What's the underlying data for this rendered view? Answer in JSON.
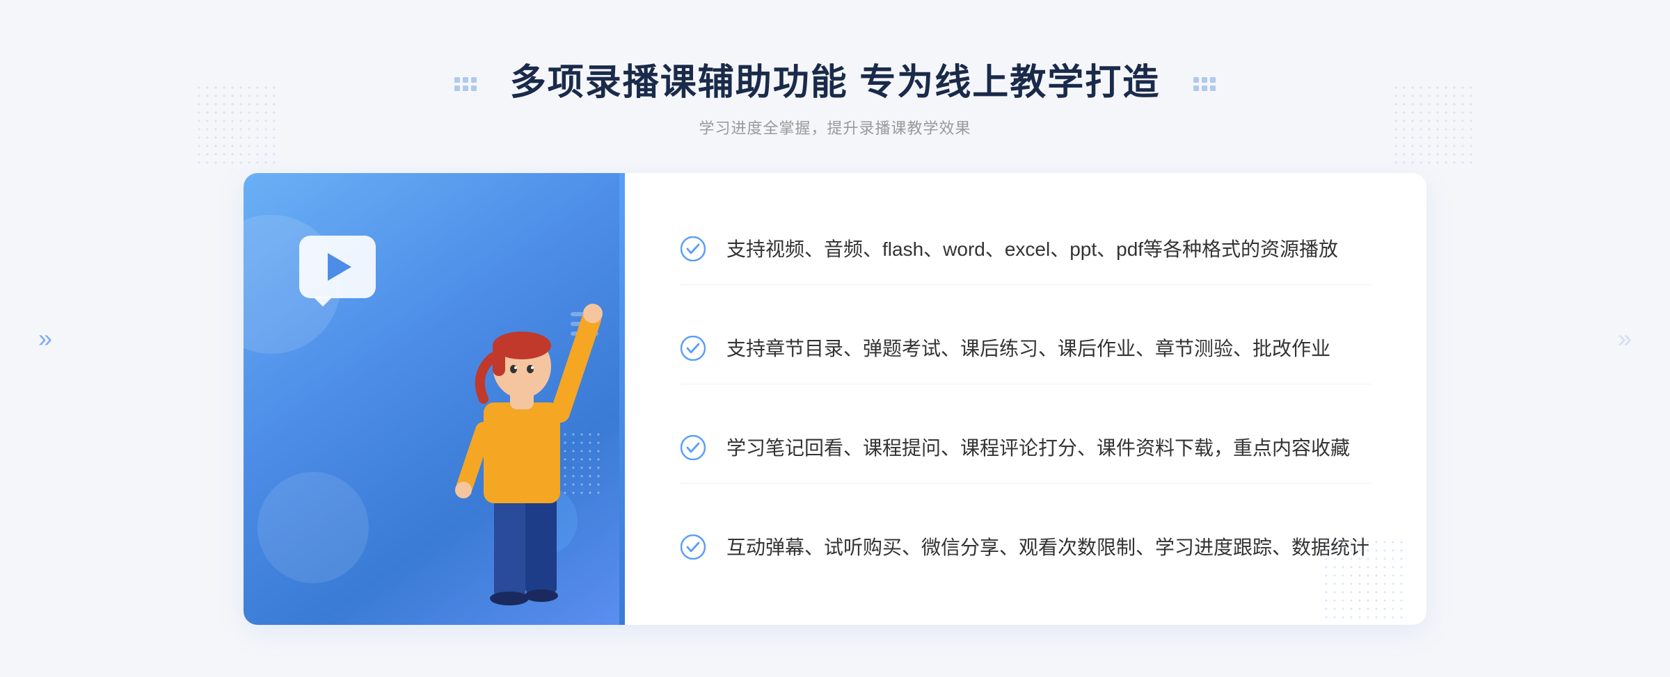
{
  "header": {
    "main_title": "多项录播课辅助功能 专为线上教学打造",
    "sub_title": "学习进度全掌握，提升录播课教学效果"
  },
  "features": [
    {
      "id": 1,
      "text": "支持视频、音频、flash、word、excel、ppt、pdf等各种格式的资源播放"
    },
    {
      "id": 2,
      "text": "支持章节目录、弹题考试、课后练习、课后作业、章节测验、批改作业"
    },
    {
      "id": 3,
      "text": "学习笔记回看、课程提问、课程评论打分、课件资料下载，重点内容收藏"
    },
    {
      "id": 4,
      "text": "互动弹幕、试听购买、微信分享、观看次数限制、学习进度跟踪、数据统计"
    }
  ],
  "colors": {
    "primary_blue": "#4d8de8",
    "check_color": "#5a9ef8",
    "title_color": "#1a2a4a",
    "text_color": "#333333",
    "sub_text": "#999999"
  }
}
